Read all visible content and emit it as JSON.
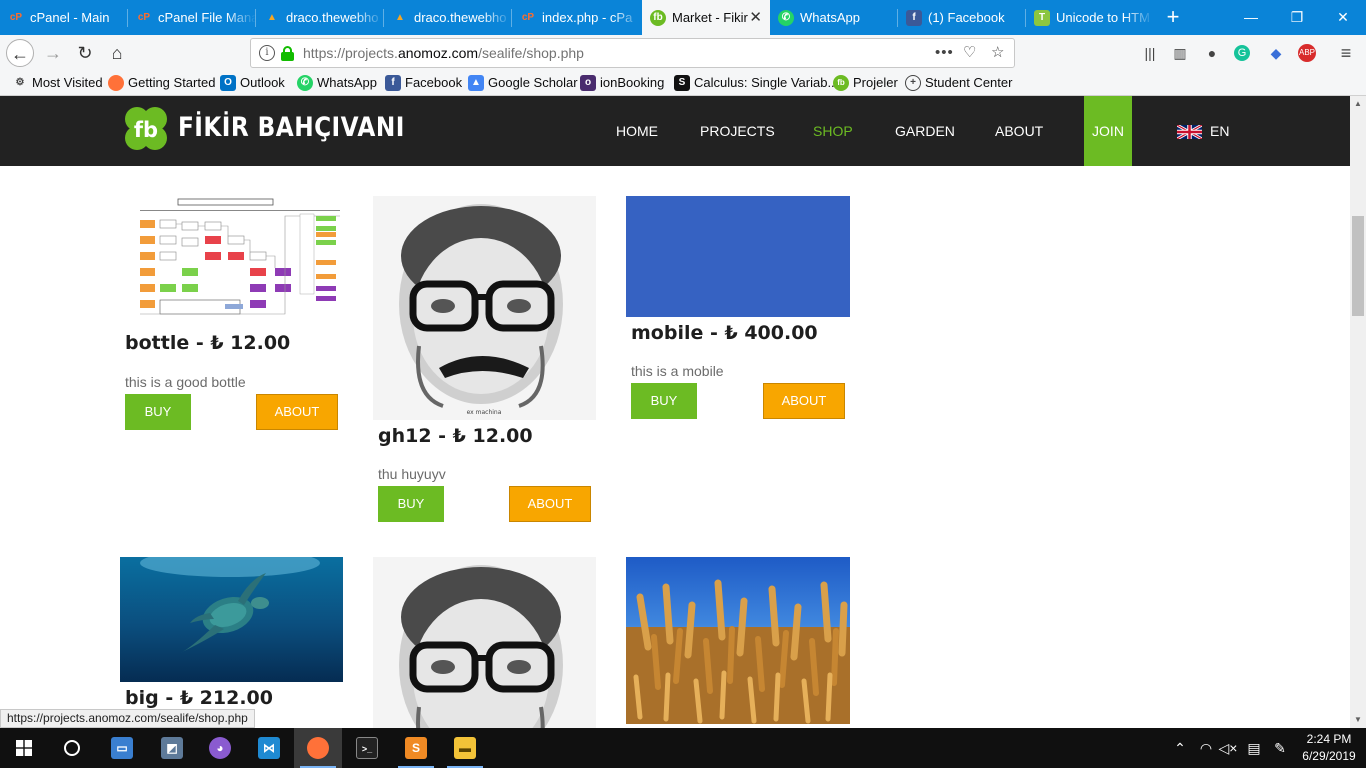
{
  "browser": {
    "tabs": [
      {
        "label": "cPanel - Main",
        "icon": "cpanel-icon"
      },
      {
        "label": "cPanel File Mana",
        "icon": "cpanel-icon"
      },
      {
        "label": "draco.thewebho",
        "icon": "webhost-icon"
      },
      {
        "label": "draco.thewebho",
        "icon": "webhost-icon"
      },
      {
        "label": "index.php - cPa",
        "icon": "cpanel-icon"
      },
      {
        "label": "Market - Fikir",
        "icon": "fb-icon"
      },
      {
        "label": "WhatsApp",
        "icon": "whatsapp-icon"
      },
      {
        "label": "(1) Facebook",
        "icon": "facebook-icon"
      },
      {
        "label": "Unicode to HTM",
        "icon": "unicode-icon"
      }
    ],
    "url_prefix": "https://projects.",
    "url_domain": "anomoz.com",
    "url_path": "/sealife/shop.php",
    "bookmarks": [
      {
        "label": "Most Visited",
        "icon": "gear-icon"
      },
      {
        "label": "Getting Started",
        "icon": "firefox-icon"
      },
      {
        "label": "Outlook",
        "icon": "outlook-icon"
      },
      {
        "label": "WhatsApp",
        "icon": "whatsapp-icon"
      },
      {
        "label": "Facebook",
        "icon": "facebook-icon"
      },
      {
        "label": "Google Scholar",
        "icon": "scholar-icon"
      },
      {
        "label": "ionBooking",
        "icon": "ionbooking-icon"
      },
      {
        "label": "Calculus: Single Variab...",
        "icon": "calculus-icon"
      },
      {
        "label": "Projeler",
        "icon": "fb-icon"
      },
      {
        "label": "Student Center",
        "icon": "globe-icon"
      }
    ],
    "status_url": "https://projects.anomoz.com/sealife/shop.php"
  },
  "site": {
    "logo_text": "FİKİR BAHÇIVANI",
    "logo_mark": "fb",
    "menu": {
      "home": "HOME",
      "projects": "PROJECTS",
      "shop": "SHOP",
      "garden": "GARDEN",
      "about": "ABOUT",
      "join": "JOIN",
      "lang": "EN"
    },
    "accent_color": "#6cbb23",
    "about_button_color": "#f8a600"
  },
  "products": [
    {
      "title": "bottle - ₺ 12.00",
      "description": "this is a good bottle",
      "buy": "BUY",
      "about": "ABOUT",
      "image": "flowchart-image"
    },
    {
      "title": "gh12 - ₺ 12.00",
      "description": "thu huyuyv",
      "buy": "BUY",
      "about": "ABOUT",
      "image": "portrait-sketch-image",
      "caption": "ex machina"
    },
    {
      "title": "mobile - ₺ 400.00",
      "description": "this is a mobile",
      "buy": "BUY",
      "about": "ABOUT",
      "image": "blue-square-image"
    },
    {
      "title": "big - ₺ 212.00",
      "image": "sea-turtle-image"
    },
    {
      "image": "portrait-sketch-image"
    },
    {
      "image": "wheat-field-image"
    }
  ],
  "taskbar": {
    "time": "2:24 PM",
    "date": "6/29/2019"
  }
}
